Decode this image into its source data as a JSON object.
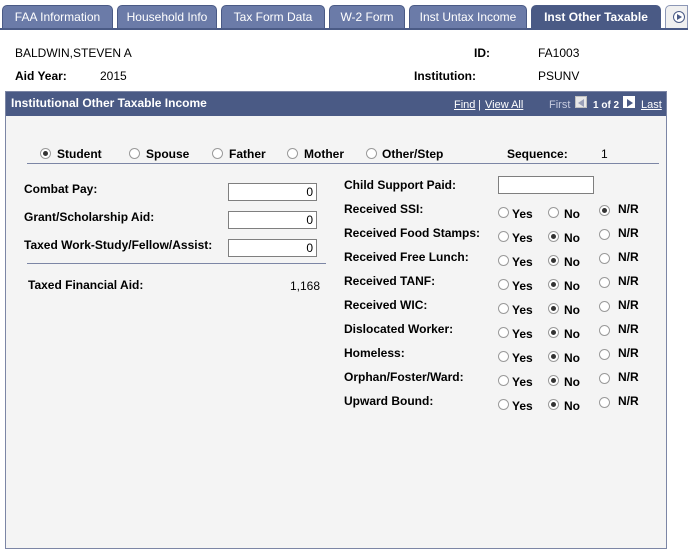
{
  "tabs": [
    "FAA Information",
    "Household Info",
    "Tax Form Data",
    "W-2 Form",
    "Inst Untax Income",
    "Inst Other Taxable"
  ],
  "header": {
    "name": "BALDWIN,STEVEN A",
    "id_label": "ID:",
    "id_value": "FA1003",
    "aid_year_label": "Aid Year:",
    "aid_year_value": "2015",
    "institution_label": "Institution:",
    "institution_value": "PSUNV"
  },
  "group": {
    "title": "Institutional Other Taxable Income",
    "find": "Find",
    "separator": "|",
    "view_all": "View All",
    "first": "First",
    "page_info": "1 of 2",
    "last": "Last"
  },
  "person_options": [
    {
      "label": "Student",
      "selected": true
    },
    {
      "label": "Spouse",
      "selected": false
    },
    {
      "label": "Father",
      "selected": false
    },
    {
      "label": "Mother",
      "selected": false
    },
    {
      "label": "Other/Step",
      "selected": false
    }
  ],
  "sequence": {
    "label": "Sequence:",
    "value": "1"
  },
  "left_fields": [
    {
      "label": "Combat Pay:",
      "value": "0"
    },
    {
      "label": "Grant/Scholarship Aid:",
      "value": "0"
    },
    {
      "label": "Taxed Work-Study/Fellow/Assist:",
      "value": "0"
    }
  ],
  "taxed_financial_aid": {
    "label": "Taxed Financial Aid:",
    "value": "1,168"
  },
  "child_support": {
    "label": "Child Support Paid:",
    "value": ""
  },
  "radio_labels": {
    "yes": "Yes",
    "no": "No",
    "nr": "N/R"
  },
  "questions": [
    {
      "label": "Received SSI:",
      "selected": "nr"
    },
    {
      "label": "Received Food Stamps:",
      "selected": "no"
    },
    {
      "label": "Received Free Lunch:",
      "selected": "no"
    },
    {
      "label": "Received TANF:",
      "selected": "no"
    },
    {
      "label": "Received WIC:",
      "selected": "no"
    },
    {
      "label": "Dislocated Worker:",
      "selected": "no"
    },
    {
      "label": "Homeless:",
      "selected": "no"
    },
    {
      "label": "Orphan/Foster/Ward:",
      "selected": "no"
    },
    {
      "label": "Upward Bound:",
      "selected": "no"
    }
  ]
}
